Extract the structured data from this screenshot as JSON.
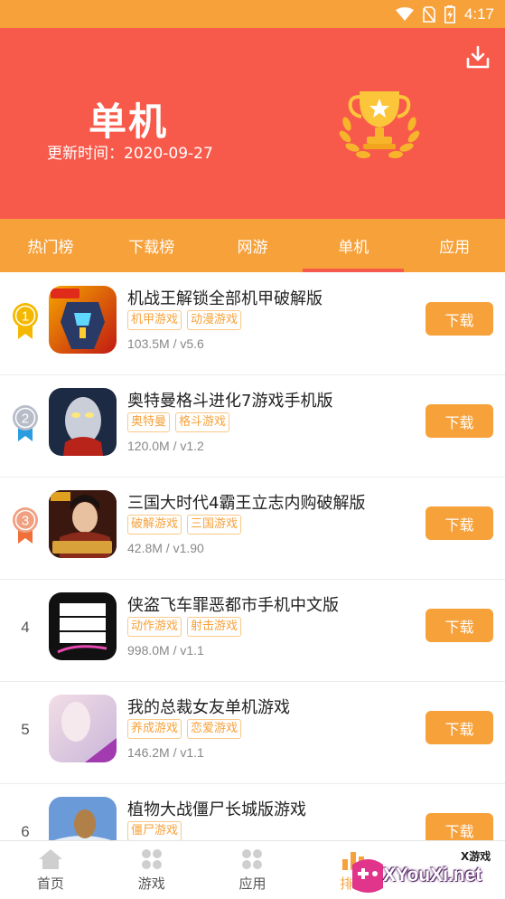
{
  "status_bar": {
    "time": "4:17"
  },
  "header": {
    "title": "单机",
    "update_label": "更新时间：",
    "update_date": "2020-09-27",
    "download_icon": "download-icon",
    "trophy_icon": "trophy-icon"
  },
  "tabs": [
    {
      "label": "热门榜",
      "active": false
    },
    {
      "label": "下载榜",
      "active": false
    },
    {
      "label": "网游",
      "active": false
    },
    {
      "label": "单机",
      "active": true
    },
    {
      "label": "应用",
      "active": false
    }
  ],
  "list": [
    {
      "rank": "1",
      "medal": "gold",
      "name": "机战王解锁全部机甲破解版",
      "tags": [
        "机甲游戏",
        "动漫游戏"
      ],
      "meta": "103.5M / v5.6",
      "button": "下载"
    },
    {
      "rank": "2",
      "medal": "silver",
      "name": "奥特曼格斗进化7游戏手机版",
      "tags": [
        "奥特曼",
        "格斗游戏"
      ],
      "meta": "120.0M / v1.2",
      "button": "下载"
    },
    {
      "rank": "3",
      "medal": "bronze",
      "name": "三国大时代4霸王立志内购破解版",
      "tags": [
        "破解游戏",
        "三国游戏"
      ],
      "meta": "42.8M / v1.90",
      "button": "下载"
    },
    {
      "rank": "4",
      "medal": "",
      "name": "侠盗飞车罪恶都市手机中文版",
      "tags": [
        "动作游戏",
        "射击游戏"
      ],
      "meta": "998.0M / v1.1",
      "button": "下载"
    },
    {
      "rank": "5",
      "medal": "",
      "name": "我的总裁女友单机游戏",
      "tags": [
        "养成游戏",
        "恋爱游戏"
      ],
      "meta": "146.2M / v1.1",
      "button": "下载"
    },
    {
      "rank": "6",
      "medal": "",
      "name": "植物大战僵尸长城版游戏",
      "tags": [
        "僵尸游戏"
      ],
      "meta": "",
      "button": "下载"
    }
  ],
  "bottom_nav": [
    {
      "label": "首页",
      "icon": "home-icon",
      "active": false
    },
    {
      "label": "游戏",
      "icon": "grid-icon",
      "active": false
    },
    {
      "label": "应用",
      "icon": "apps-icon",
      "active": false
    },
    {
      "label": "排行",
      "icon": "ranking-icon",
      "active": true
    }
  ],
  "watermark": {
    "top_text": "X游戏",
    "brand": "XYouXi.net"
  },
  "colors": {
    "orange": "#f7a13a",
    "red": "#f75a4a",
    "gold": "#f5b800",
    "silver": "#b7bcc8",
    "bronze": "#f08a6a"
  }
}
